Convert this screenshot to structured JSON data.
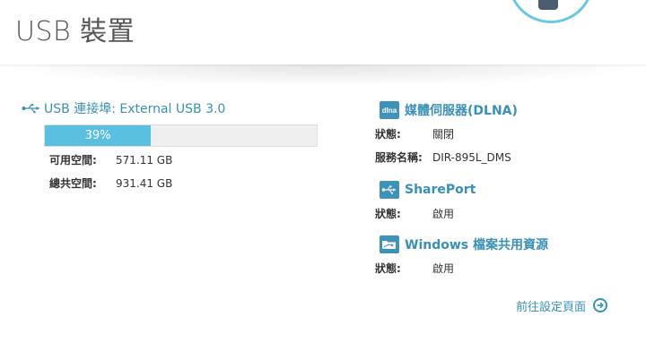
{
  "header": {
    "title": "USB 裝置"
  },
  "usb": {
    "connection_label": "USB 連接埠: External USB 3.0",
    "usage_percent": 39,
    "usage_text": "39%",
    "free_label": "可用空間:",
    "free_value": "571.11 GB",
    "total_label": "總共空間:",
    "total_value": "931.41 GB"
  },
  "dlna": {
    "icon_text": "dlna",
    "title": "媒體伺服器(DLNA)",
    "status_label": "狀態:",
    "status_value": "關閉",
    "service_label": "服務名稱:",
    "service_value": "DIR-895L_DMS"
  },
  "shareport": {
    "title": "SharePort",
    "status_label": "狀態:",
    "status_value": "啟用"
  },
  "windows_share": {
    "title": "Windows 檔案共用資源",
    "status_label": "狀態:",
    "status_value": "啟用"
  },
  "goto_settings_label": "前往設定頁面",
  "colors": {
    "accent": "#3a8fb4",
    "progress_fill": "#5bbfe0",
    "icon_bg": "#3f93b8"
  },
  "icons": {
    "usb": "usb-icon",
    "dlna": "dlna-icon",
    "shareport": "shareport-icon",
    "windows_share": "windows-share-icon",
    "goto": "arrow-right-circle-icon"
  }
}
